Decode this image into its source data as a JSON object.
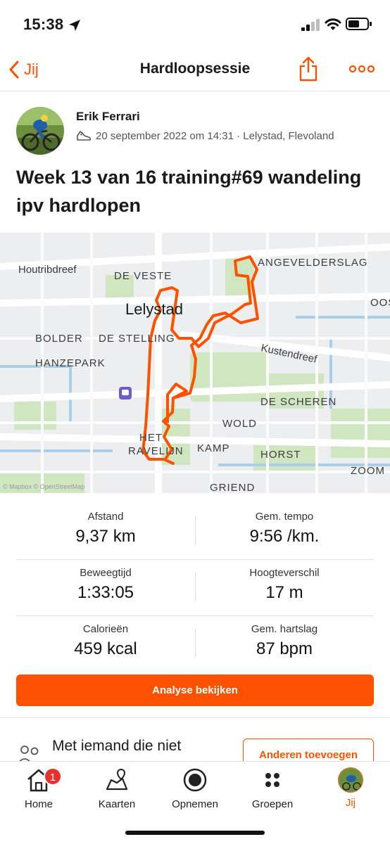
{
  "status_bar": {
    "time": "15:38"
  },
  "nav": {
    "back_label": "Jij",
    "title": "Hardloopsessie"
  },
  "activity": {
    "athlete_name": "Erik Ferrari",
    "meta": "20 september 2022 om 14:31 · Lelystad, Flevoland",
    "title": "Week 13 van 16 training#69 wandeling ipv hardlopen"
  },
  "map": {
    "labels": {
      "houtribdreef": "Houtribdreef",
      "de_veste": "DE VESTE",
      "angevelderslag": "ANGEVELDERSLAG",
      "lelystad": "Lelystad",
      "oos": "OOS",
      "bolder": "BOLDER",
      "de_stelling": "DE STELLING",
      "kustendreef": "Kustendreef",
      "hanzepark": "HANZEPARK",
      "de_scheren": "DE SCHEREN",
      "wold": "WOLD",
      "het_ravelijn_1": "HET",
      "het_ravelijn_2": "RAVELIJN",
      "kamp": "KAMP",
      "horst": "HORST",
      "zoom": "ZOOM",
      "griend": "GRIEND",
      "attribution": "© Mapbox © OpenStreetMap"
    },
    "route_color": "#fc5200"
  },
  "stats": [
    {
      "left_label": "Afstand",
      "left_value": "9,37 km",
      "right_label": "Gem. tempo",
      "right_value": "9:56 /km."
    },
    {
      "left_label": "Beweegtijd",
      "left_value": "1:33:05",
      "right_label": "Hoogteverschil",
      "right_value": "17 m"
    },
    {
      "left_label": "Calorieën",
      "left_value": "459 kcal",
      "right_label": "Gem. hartslag",
      "right_value": "87 bpm"
    }
  ],
  "analyse_button": "Analyse bekijken",
  "invite": {
    "text": "Met iemand die niet",
    "button": "Anderen toevoegen"
  },
  "tabbar": {
    "items": [
      {
        "label": "Home",
        "icon": "home-icon",
        "badge": "1"
      },
      {
        "label": "Kaarten",
        "icon": "map-icon"
      },
      {
        "label": "Opnemen",
        "icon": "record-icon"
      },
      {
        "label": "Groepen",
        "icon": "groups-icon"
      },
      {
        "label": "Jij",
        "icon": "avatar-icon"
      }
    ]
  },
  "colors": {
    "accent": "#fc5200",
    "badge": "#e8312c"
  }
}
